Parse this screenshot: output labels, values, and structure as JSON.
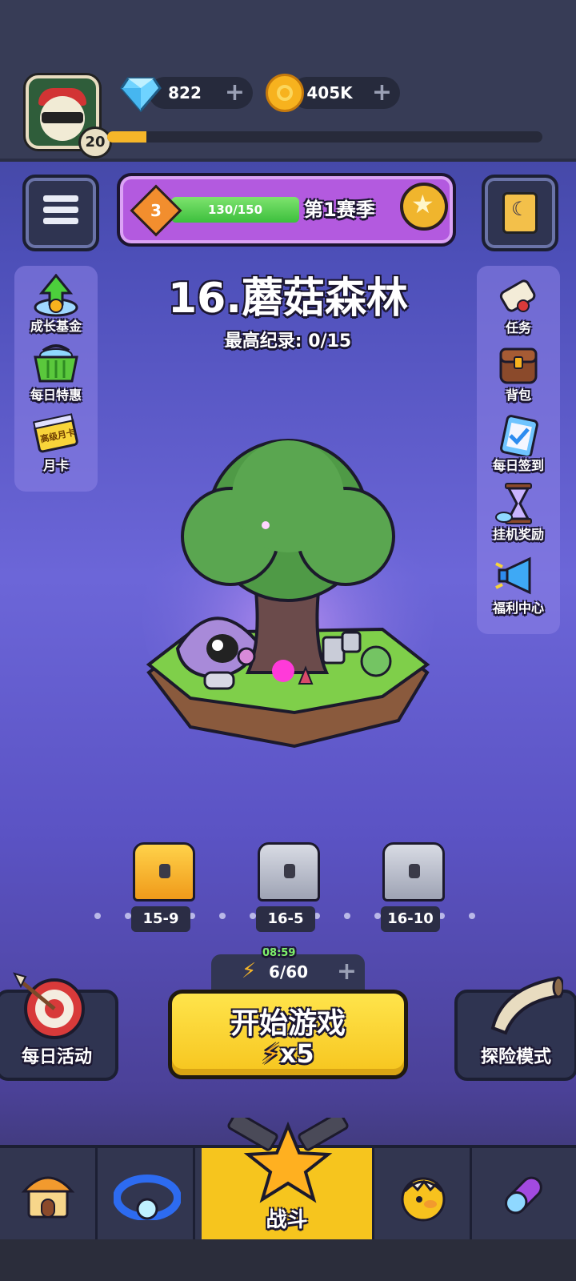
{
  "header": {
    "player_level": "20",
    "xp_progress": 0.09,
    "gems": "822",
    "coins": "405K",
    "plus": "+"
  },
  "season": {
    "rank": "3",
    "progress_text": "130/150",
    "progress": 1.0,
    "label": "第1赛季"
  },
  "stage": {
    "title": "16.蘑菇森林",
    "record": "最高纪录: 0/15"
  },
  "left_menu": [
    {
      "label": "成长基金",
      "icon": "growth-fund-icon"
    },
    {
      "label": "每日特惠",
      "icon": "shopping-basket-icon"
    },
    {
      "label": "月卡",
      "icon": "monthly-card-icon",
      "badge": "高级月卡"
    }
  ],
  "right_menu": [
    {
      "label": "任务",
      "icon": "scroll-icon"
    },
    {
      "label": "背包",
      "icon": "backpack-icon"
    },
    {
      "label": "每日签到",
      "icon": "clipboard-check-icon"
    },
    {
      "label": "挂机奖励",
      "icon": "hourglass-icon"
    },
    {
      "label": "福利中心",
      "icon": "megaphone-icon"
    }
  ],
  "chests": [
    {
      "label": "15-9",
      "type": "gold"
    },
    {
      "label": "16-5",
      "type": "silver"
    },
    {
      "label": "16-10",
      "type": "silver"
    }
  ],
  "energy": {
    "timer": "08:59",
    "value": "6/60"
  },
  "actions": {
    "start_label": "开始游戏",
    "start_cost_x": "x",
    "start_cost_n": "5",
    "daily_label": "每日活动",
    "adventure_label": "探险模式"
  },
  "nav": {
    "tabs": [
      "shop-icon",
      "ring-icon",
      "battle-icon",
      "pet-egg-icon",
      "capsule-icon"
    ],
    "active_label": "战斗"
  },
  "colors": {
    "accent_yellow": "#f6c51e",
    "season_purple": "#b35adf",
    "energy_green": "#7ef06a"
  }
}
